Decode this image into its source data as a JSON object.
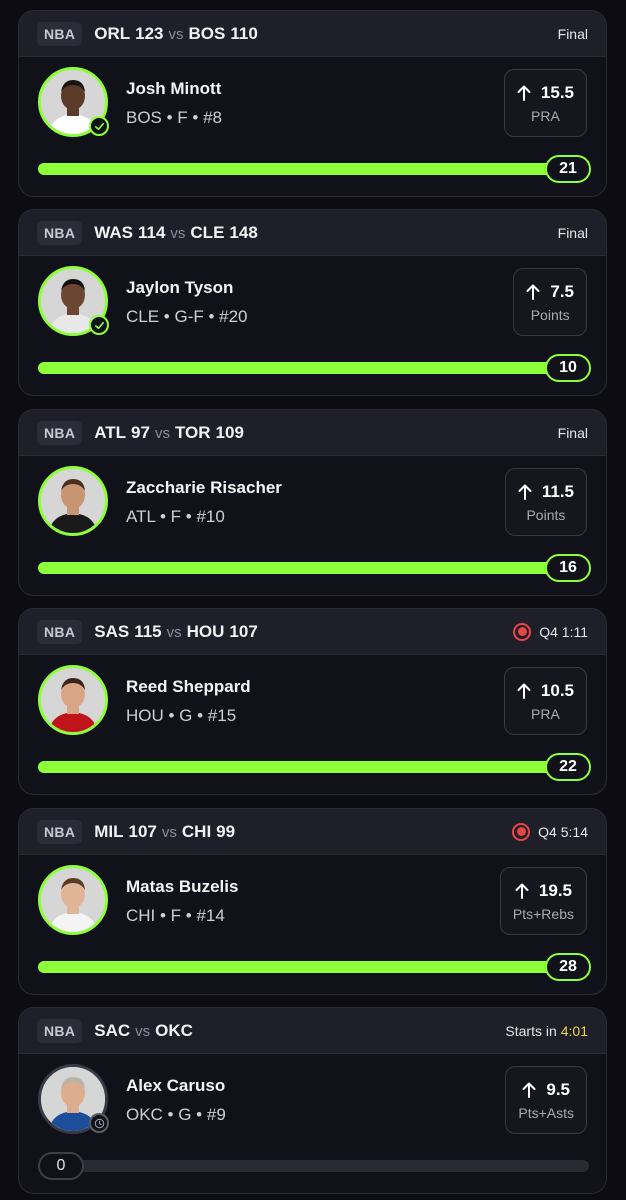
{
  "cards": [
    {
      "league": "NBA",
      "away_team": "ORL",
      "away_score": "123",
      "vs": "vs",
      "home_team": "BOS",
      "home_score": "110",
      "status": "Final",
      "status_type": "final",
      "player_name": "Josh Minott",
      "player_meta": "BOS • F • #8",
      "line": "15.5",
      "stat": "PRA",
      "value": "21",
      "progress": 1.0,
      "icon": "check-icon"
    },
    {
      "league": "NBA",
      "away_team": "WAS",
      "away_score": "114",
      "vs": "vs",
      "home_team": "CLE",
      "home_score": "148",
      "status": "Final",
      "status_type": "final",
      "player_name": "Jaylon Tyson",
      "player_meta": "CLE • G-F • #20",
      "line": "7.5",
      "stat": "Points",
      "value": "10",
      "progress": 1.0,
      "icon": "check-icon"
    },
    {
      "league": "NBA",
      "away_team": "ATL",
      "away_score": "97",
      "vs": "vs",
      "home_team": "TOR",
      "home_score": "109",
      "status": "Final",
      "status_type": "final",
      "player_name": "Zaccharie Risacher",
      "player_meta": "ATL • F • #10",
      "line": "11.5",
      "stat": "Points",
      "value": "16",
      "progress": 1.0,
      "icon": ""
    },
    {
      "league": "NBA",
      "away_team": "SAS",
      "away_score": "115",
      "vs": "vs",
      "home_team": "HOU",
      "home_score": "107",
      "status": "Q4 1:11",
      "status_type": "live",
      "player_name": "Reed Sheppard",
      "player_meta": "HOU • G • #15",
      "line": "10.5",
      "stat": "PRA",
      "value": "22",
      "progress": 1.0,
      "icon": ""
    },
    {
      "league": "NBA",
      "away_team": "MIL",
      "away_score": "107",
      "vs": "vs",
      "home_team": "CHI",
      "home_score": "99",
      "status": "Q4 5:14",
      "status_type": "live",
      "player_name": "Matas Buzelis",
      "player_meta": "CHI • F • #14",
      "line": "19.5",
      "stat": "Pts+Rebs",
      "value": "28",
      "progress": 1.0,
      "icon": ""
    },
    {
      "league": "NBA",
      "away_team": "SAC",
      "away_score": "",
      "vs": "vs",
      "home_team": "OKC",
      "home_score": "",
      "status": "Starts in",
      "countdown": "4:01",
      "status_type": "upcoming",
      "player_name": "Alex Caruso",
      "player_meta": "OKC • G • #9",
      "line": "9.5",
      "stat": "Pts+Asts",
      "value": "0",
      "progress": 0.0,
      "icon": "clock-icon"
    }
  ],
  "colors": {
    "accent": "#8dff3a",
    "live": "#e84545",
    "countdown": "#e9d64a",
    "card_bg": "#111119",
    "header_bg": "#1f1f29"
  }
}
